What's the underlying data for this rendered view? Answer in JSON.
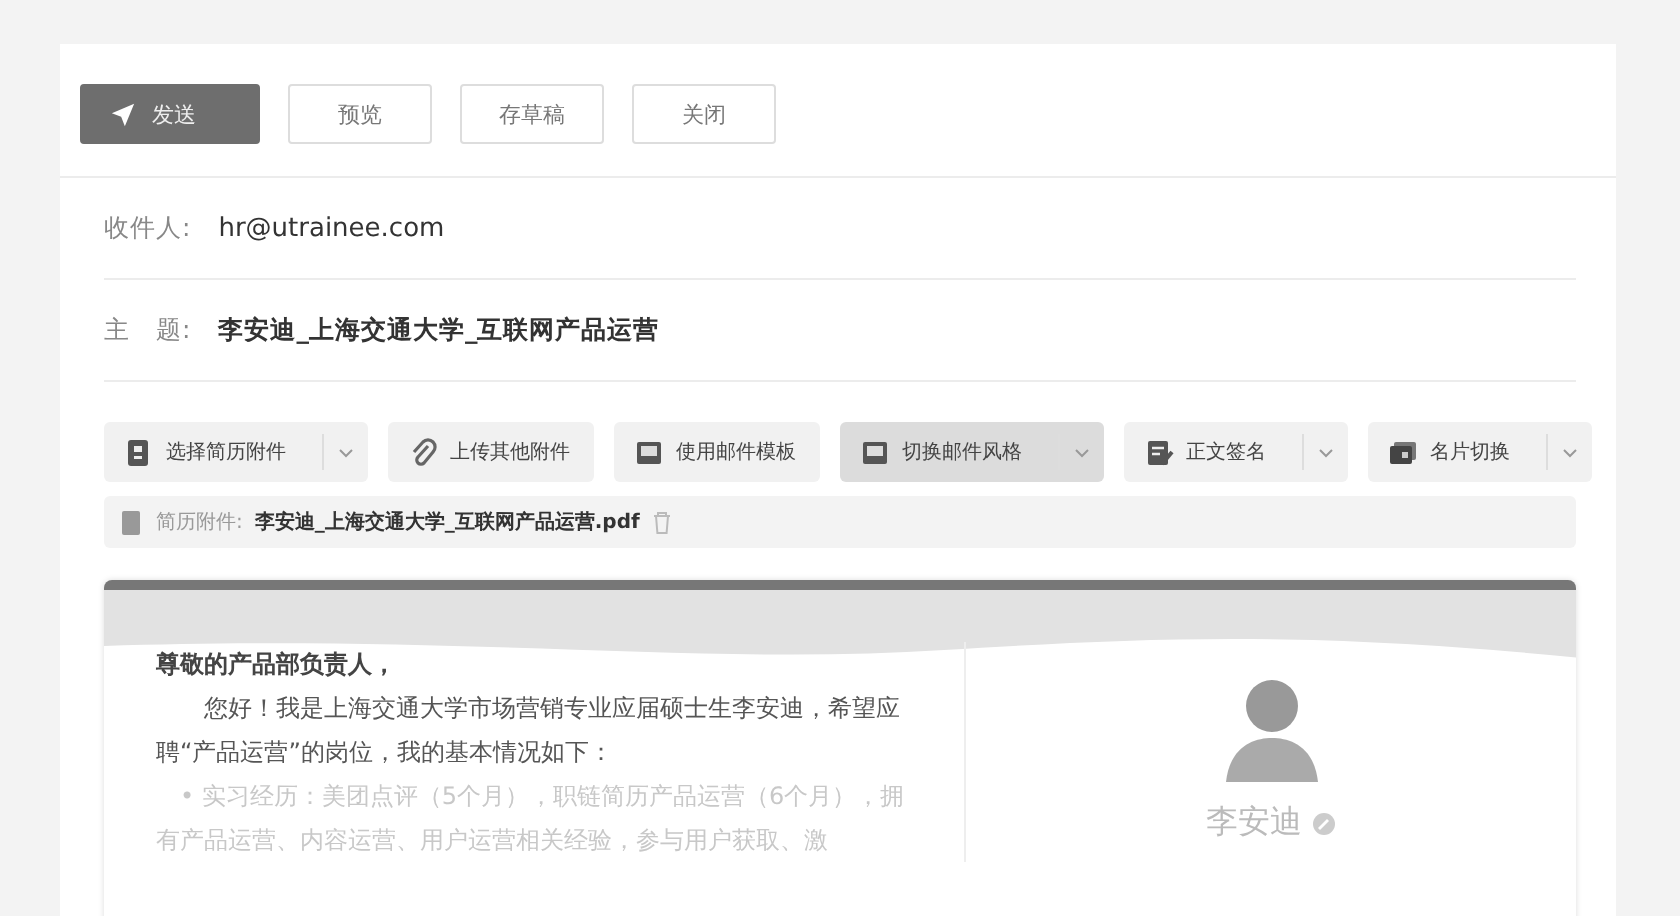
{
  "actions": [
    {
      "label": "发送",
      "kind": "primary"
    },
    {
      "label": "预览",
      "kind": "plain"
    },
    {
      "label": "存草稿",
      "kind": "plain"
    },
    {
      "label": "关闭",
      "kind": "plain"
    }
  ],
  "recipient": {
    "label": "收件人:",
    "value": "hr@utrainee.com"
  },
  "subject": {
    "label": "主　题:",
    "value": "李安迪_上海交通大学_互联网产品运营"
  },
  "toolbar": [
    {
      "label": "选择简历附件",
      "dropdown": true,
      "selected": false
    },
    {
      "label": "上传其他附件",
      "dropdown": false,
      "selected": false
    },
    {
      "label": "使用邮件模板",
      "dropdown": false,
      "selected": false
    },
    {
      "label": "切换邮件风格",
      "dropdown": true,
      "selected": true
    },
    {
      "label": "正文签名",
      "dropdown": true,
      "selected": false
    },
    {
      "label": "名片切换",
      "dropdown": true,
      "selected": false
    }
  ],
  "attachment": {
    "label": "简历附件:",
    "file": "李安迪_上海交通大学_互联网产品运营.pdf"
  },
  "letter": {
    "greeting": "尊敬的产品部负责人，",
    "paragraph": "您好！我是上海交通大学市场营销专业应届硕士生李安迪，希望应聘“产品运营”的岗位，我的基本情况如下：",
    "bullet_mark": "•",
    "bullet": "实习经历：美团点评（5个月），职链简历产品运营（6个月），拥有产品运营、内容运营、用户运营相关经验，参与用户获取、激"
  },
  "profile": {
    "name": "李安迪"
  }
}
